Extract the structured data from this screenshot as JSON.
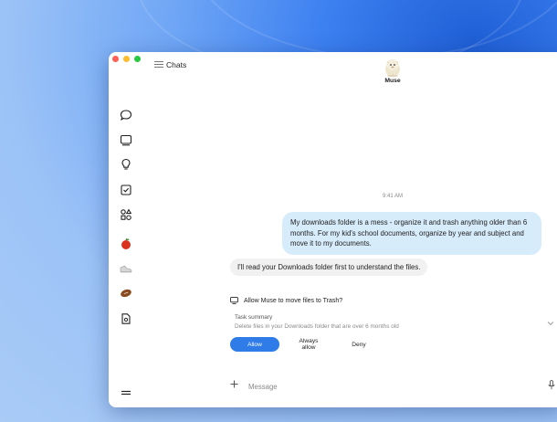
{
  "window": {
    "traffic_colors": [
      "#ff5f57",
      "#febc2e",
      "#28c840"
    ]
  },
  "header": {
    "menu_icon": "hamburger-menu-icon",
    "chats_title": "Chats",
    "assistant_name": "Muse"
  },
  "sidebar": {
    "icons": [
      "chat-bubble-icon",
      "browser-window-icon",
      "lightbulb-icon",
      "checkbox-icon",
      "apps-grid-icon",
      "apple-emoji-icon",
      "sneaker-emoji-icon",
      "football-emoji-icon",
      "document-icon",
      "menu-bars-icon"
    ]
  },
  "conversation": {
    "timestamp": "9:41 AM",
    "user_message": "My downloads folder is a mess - organize it and trash anything older than 6 months. For my kid's school documents, organize by year and subject and move it to my documents.",
    "assistant_message": "I'll read your Downloads folder first to understand the files."
  },
  "permission": {
    "icon": "monitor-icon",
    "title": "Allow Muse to move files to Trash?",
    "task_summary_label": "Task summary",
    "task_summary_text": "Delete files in your Downloads folder that are over 6 months old",
    "buttons": {
      "allow": "Allow",
      "always_allow": "Always allow",
      "deny": "Deny"
    }
  },
  "composer": {
    "placeholder": "Message",
    "value": ""
  },
  "colors": {
    "accent": "#2f7be8",
    "user_bubble": "#d7ecfb",
    "assistant_bubble": "#f1f1f1"
  }
}
